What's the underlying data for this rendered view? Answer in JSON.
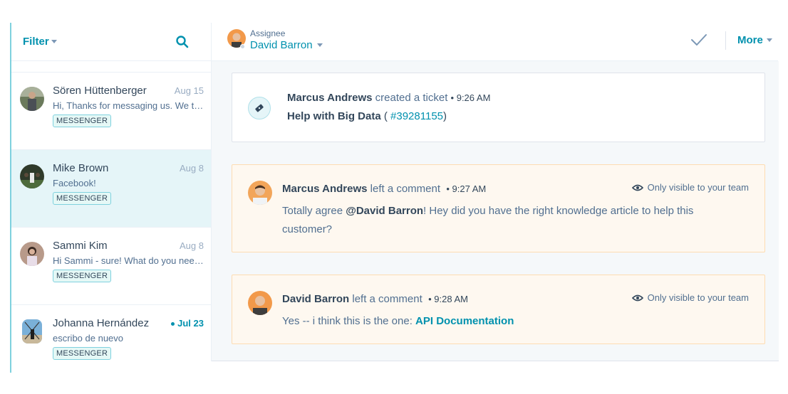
{
  "sidebar": {
    "filter_label": "Filter",
    "search_icon": "search-icon",
    "conversations": [
      {
        "name": "Sören Hüttenberger",
        "date": "Aug 15",
        "preview": "Hi, Thanks for messaging us. We tr...",
        "channel": "MESSENGER",
        "unread": false,
        "selected": false
      },
      {
        "name": "Mike Brown",
        "date": "Aug 8",
        "preview": "Facebook!",
        "channel": "MESSENGER",
        "unread": false,
        "selected": true
      },
      {
        "name": "Sammi Kim",
        "date": "Aug 8",
        "preview": "Hi Sammi - sure! What do you need?",
        "channel": "MESSENGER",
        "unread": false,
        "selected": false
      },
      {
        "name": "Johanna Hernández",
        "date": "Jul 23",
        "preview": "escribo de nuevo",
        "channel": "MESSENGER",
        "unread": true,
        "selected": false
      }
    ]
  },
  "header": {
    "assignee_label": "Assignee",
    "assignee_name": "David Barron",
    "check_icon": "check-icon",
    "more_label": "More"
  },
  "timeline": {
    "ticket": {
      "author": "Marcus Andrews",
      "action": "created a ticket",
      "time": "• 9:26 AM",
      "title": "Help with Big Data",
      "ticket_open": " ( ",
      "ticket_id": "#39281155",
      "ticket_close": ")"
    },
    "comments": [
      {
        "author": "Marcus Andrews",
        "action": "left a comment",
        "time": "• 9:27 AM",
        "visibility": "Only visible to your team",
        "body_prefix": "Totally agree ",
        "mention": "@David Barron",
        "body_suffix": "! Hey did you have the right knowledge article to help this customer?"
      },
      {
        "author": "David Barron",
        "action": "left a comment",
        "time": "• 9:28 AM",
        "visibility": "Only visible to your team",
        "body_prefix": "Yes -- i think this is the one: ",
        "link": "API Documentation"
      }
    ]
  },
  "colors": {
    "accent": "#0091ae",
    "text_dark": "#33475b",
    "text_muted": "#516f90",
    "selected_bg": "#e5f5f8",
    "note_bg": "#fef8f0",
    "note_border": "#fddcb2"
  }
}
